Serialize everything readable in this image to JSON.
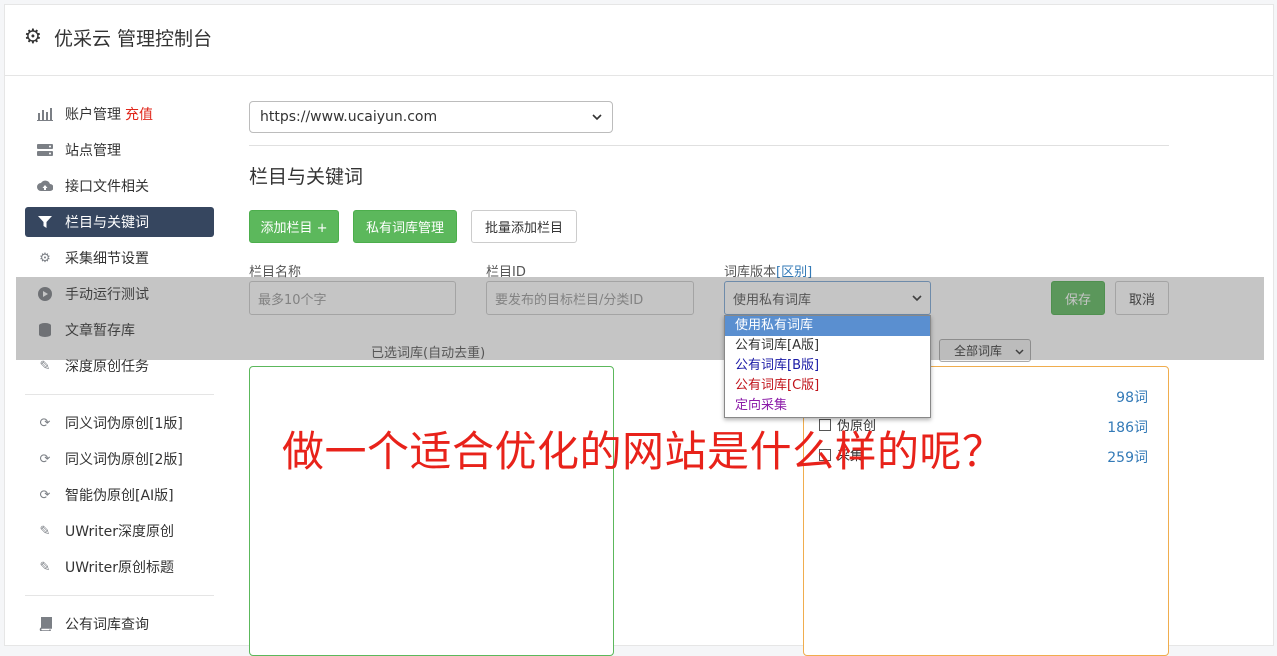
{
  "header": {
    "title": "优采云 管理控制台",
    "icon": "gear-icon"
  },
  "sidebar": {
    "items": [
      {
        "label": "账户管理",
        "icon": "bar-chart-icon",
        "extra": "充值"
      },
      {
        "label": "站点管理",
        "icon": "server-icon"
      },
      {
        "label": "接口文件相关",
        "icon": "cloud-upload-icon"
      },
      {
        "label": "栏目与关键词",
        "icon": "filter-icon"
      },
      {
        "label": "采集细节设置",
        "icon": "gears-icon"
      },
      {
        "label": "手动运行测试",
        "icon": "play-icon"
      },
      {
        "label": "文章暂存库",
        "icon": "database-icon"
      },
      {
        "label": "深度原创任务",
        "icon": "edit-icon"
      },
      {
        "label": "同义词伪原创[1版]",
        "icon": "refresh-icon"
      },
      {
        "label": "同义词伪原创[2版]",
        "icon": "refresh-icon"
      },
      {
        "label": "智能伪原创[AI版]",
        "icon": "refresh-icon"
      },
      {
        "label": "UWriter深度原创",
        "icon": "edit-icon"
      },
      {
        "label": "UWriter原创标题",
        "icon": "edit-icon"
      },
      {
        "label": "公有词库查询",
        "icon": "book-icon"
      }
    ]
  },
  "main": {
    "site_select": "https://www.ucaiyun.com",
    "section_title": "栏目与关键词",
    "buttons": {
      "add_column": "添加栏目 +",
      "private_lib": "私有词库管理",
      "batch_add": "批量添加栏目"
    },
    "form": {
      "name_label": "栏目名称",
      "name_placeholder": "最多10个字",
      "id_label": "栏目ID",
      "id_placeholder": "要发布的目标栏目/分类ID",
      "version_label": "词库版本",
      "version_link": "[区别]",
      "version_value": "使用私有词库",
      "save": "保存",
      "cancel": "取消"
    },
    "dropdown_options": [
      {
        "label": "使用私有词库",
        "color": "#ffffff"
      },
      {
        "label": "公有词库[A版]",
        "color": "#333333"
      },
      {
        "label": "公有词库[B版]",
        "color": "#1a1aa6"
      },
      {
        "label": "公有词库[C版]",
        "color": "#c0141b"
      },
      {
        "label": "定向采集",
        "color": "#8b1aa8"
      }
    ],
    "selected_label": "已选词库(自动去重)",
    "all_libs": "全部词库",
    "library_list": [
      {
        "count": "98词",
        "name": ""
      },
      {
        "count": "186词",
        "name": "伪原创"
      },
      {
        "count": "259词",
        "name": "采集"
      }
    ]
  },
  "headline": "做一个适合优化的网站是什么样的呢？",
  "colors": {
    "accent_green": "#5cb85c",
    "sidebar_active": "#36465f",
    "headline_red": "#e8221a"
  }
}
